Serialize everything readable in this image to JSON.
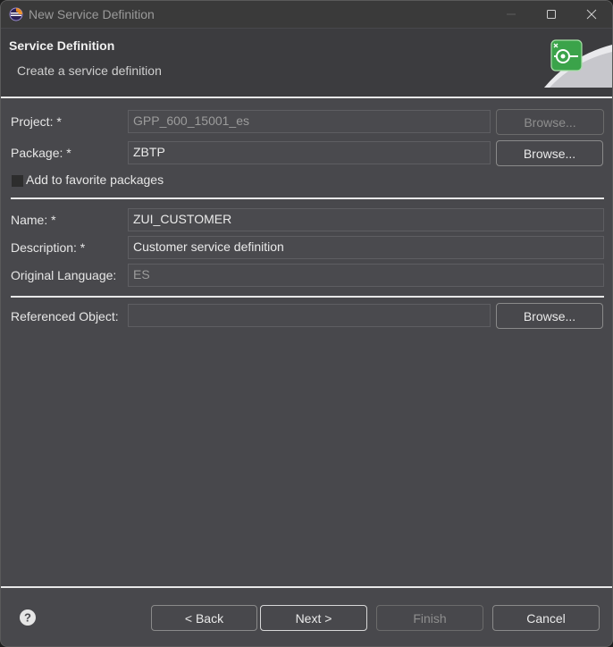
{
  "window": {
    "title": "New Service Definition"
  },
  "banner": {
    "title": "Service Definition",
    "subtitle": "Create a service definition"
  },
  "form": {
    "project": {
      "label": "Project: *",
      "value": "GPP_600_15001_es",
      "browse": "Browse..."
    },
    "package": {
      "label": "Package: *",
      "value": "ZBTP",
      "browse": "Browse..."
    },
    "favorite": {
      "label": "Add to favorite packages",
      "checked": false
    },
    "name": {
      "label": "Name: *",
      "value": "ZUI_CUSTOMER"
    },
    "description": {
      "label": "Description: *",
      "value": "Customer service definition"
    },
    "original_language": {
      "label": "Original Language:",
      "value": "ES"
    },
    "referenced_object": {
      "label": "Referenced Object:",
      "value": "",
      "browse": "Browse..."
    }
  },
  "footer": {
    "back": "< Back",
    "next": "Next >",
    "finish": "Finish",
    "cancel": "Cancel"
  },
  "icons": {
    "app": "eclipse-icon",
    "help": "help-icon",
    "wizard": "service-definition-wizard-icon"
  },
  "colors": {
    "dialog_bg": "#48484c",
    "banner_bg": "#3c3c3f",
    "accent_green": "#3ba34a"
  }
}
